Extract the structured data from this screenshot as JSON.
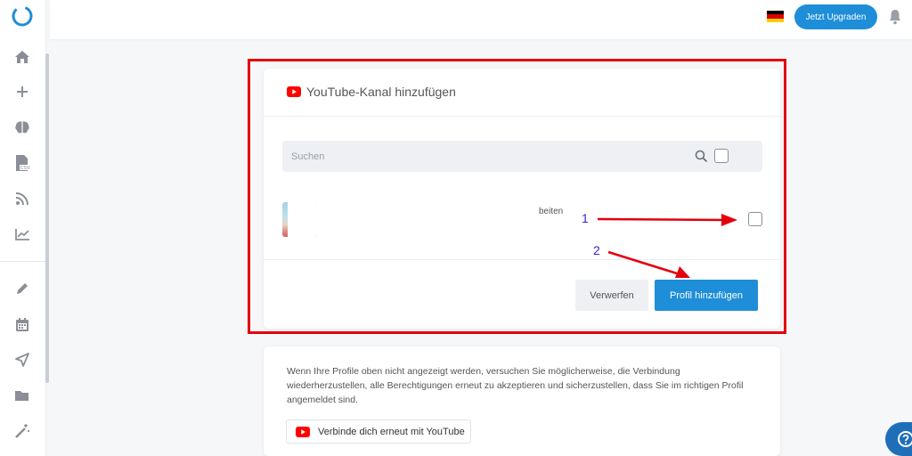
{
  "colors": {
    "accent": "#1e8ed8",
    "highlight_border": "#e3000f",
    "annotation_arrow": "#e3000f",
    "annotation_number": "#3a1fd6",
    "youtube_red": "#ff0000"
  },
  "sidebar": {
    "logo": "ring-logo",
    "items": [
      {
        "icon": "home-icon"
      },
      {
        "icon": "plus-icon"
      },
      {
        "icon": "brain-icon"
      },
      {
        "icon": "csv-file-icon"
      },
      {
        "icon": "rss-icon"
      },
      {
        "icon": "line-chart-icon"
      },
      {
        "icon": "pencil-icon"
      },
      {
        "icon": "calendar-icon"
      },
      {
        "icon": "send-icon"
      },
      {
        "icon": "folder-icon"
      },
      {
        "icon": "magic-wand-icon"
      }
    ]
  },
  "topbar": {
    "language_flag": "germany-flag",
    "upgrade_label": "Jetzt Upgraden",
    "notification_icon": "bell-icon"
  },
  "dialog": {
    "title": "YouTube-Kanal hinzufügen",
    "search_placeholder": "Suchen",
    "profile_text": "beiten",
    "discard_label": "Verwerfen",
    "add_label": "Profil hinzufügen"
  },
  "annotations": {
    "step1": "1",
    "step2": "2"
  },
  "info": {
    "text": "Wenn Ihre Profile oben nicht angezeigt werden, versuchen Sie möglicherweise, die Verbindung wiederherzustellen, alle Berechtigungen erneut zu akzeptieren und sicherzustellen, dass Sie im richtigen Profil angemeldet sind.",
    "reconnect_label": "Verbinde dich erneut mit YouTube"
  }
}
